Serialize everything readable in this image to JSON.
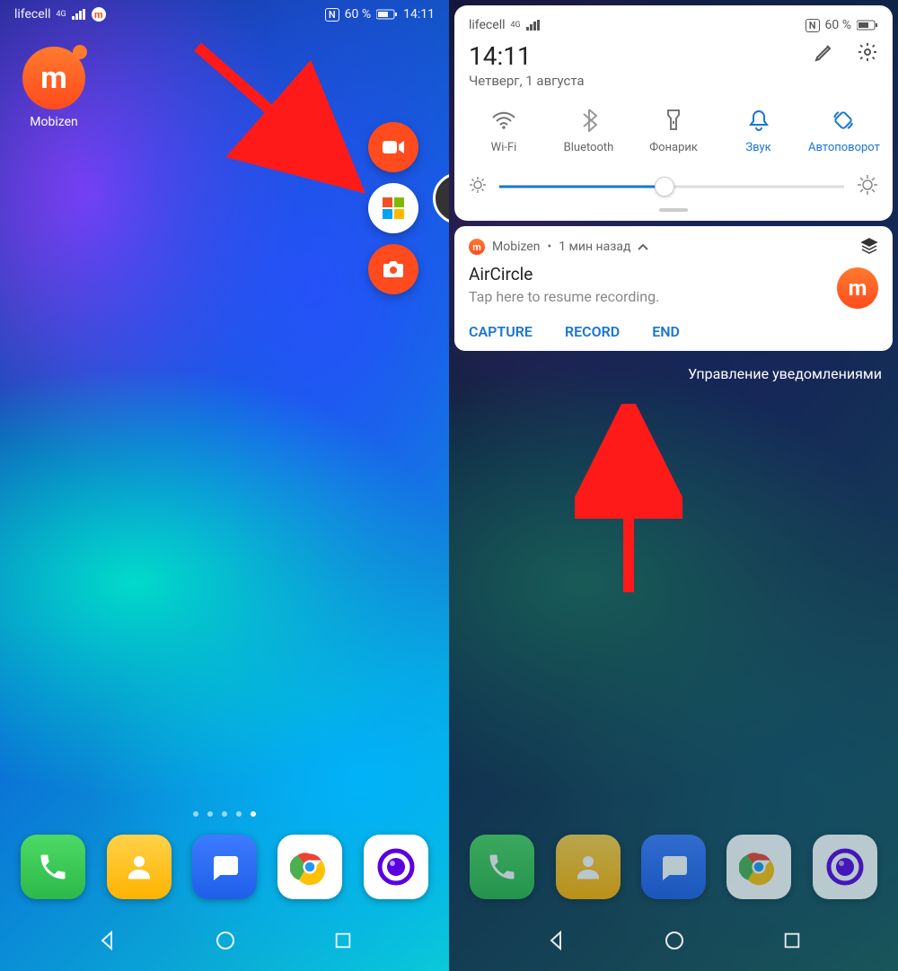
{
  "left": {
    "status": {
      "carrier": "lifecell",
      "net": "4G",
      "nfc": "N",
      "battery": "60 %",
      "time": "14:11"
    },
    "app": {
      "name": "Mobizen",
      "glyph": "m"
    }
  },
  "right": {
    "status": {
      "carrier": "lifecell",
      "net": "4G",
      "nfc": "N",
      "battery": "60 %"
    },
    "qs": {
      "time": "14:11",
      "date": "Четверг, 1 августа",
      "toggles": {
        "wifi": "Wi-Fi",
        "bluetooth": "Bluetooth",
        "torch": "Фонарик",
        "sound": "Звук",
        "rotate": "Автоповорот"
      }
    },
    "notif": {
      "app": "Mobizen",
      "when": "1 мин назад",
      "title": "AirCircle",
      "body": "Tap here to resume recording.",
      "actions": {
        "capture": "CAPTURE",
        "record": "RECORD",
        "end": "END"
      },
      "glyph": "m"
    },
    "manage": "Управление уведомлениями"
  }
}
